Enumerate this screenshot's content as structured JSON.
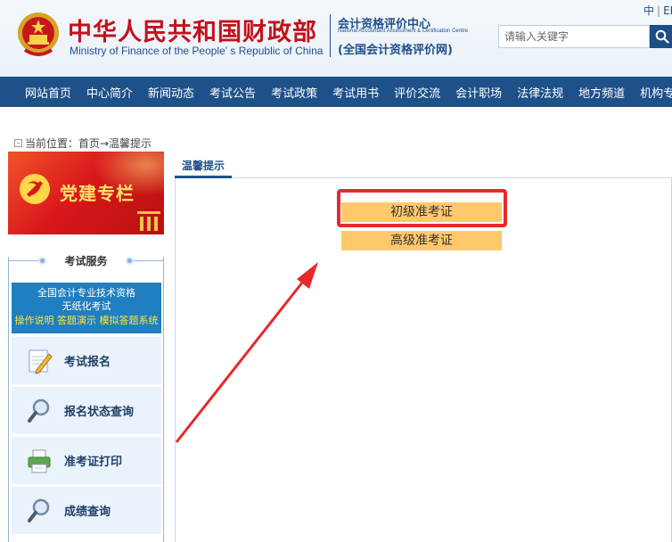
{
  "header": {
    "ministry_cn": "中华人民共和国财政部",
    "ministry_en": "Ministry of Finance of the People' s Republic of China",
    "center_cn": "会计资格评价中心",
    "center_en": "National Accountant Assessment & Certification Centre",
    "center_net": "(全国会计资格评价网)",
    "lang_cn": "中",
    "lang_sep": "|",
    "lang_en": "EN"
  },
  "search": {
    "placeholder": "请输入关键字",
    "button_icon": "search-icon"
  },
  "nav": {
    "items": [
      "网站首页",
      "中心简介",
      "新闻动态",
      "考试公告",
      "考试政策",
      "考试用书",
      "评价交流",
      "会计职场",
      "法律法规",
      "地方频道",
      "机构专区"
    ]
  },
  "breadcrumb": {
    "text": "当前位置：首页→温馨提示"
  },
  "sidebar": {
    "party_banner": "党建专栏",
    "service_title": "考试服务",
    "paperless": {
      "line1": "全国会计专业技术资格",
      "line2": "无纸化考试",
      "link1": "操作说明",
      "link2": "答题演示",
      "link3": "模拟答题系统"
    },
    "items": [
      {
        "label": "考试报名",
        "icon": "pencil-paper-icon"
      },
      {
        "label": "报名状态查询",
        "icon": "magnifier-icon"
      },
      {
        "label": "准考证打印",
        "icon": "printer-icon"
      },
      {
        "label": "成绩查询",
        "icon": "magnifier-icon"
      }
    ]
  },
  "main": {
    "tab_label": "温馨提示",
    "buttons": {
      "primary": "初级准考证",
      "senior": "高级准考证"
    }
  },
  "colors": {
    "nav_bg": "#1e5189",
    "ministry_red": "#c2121b",
    "button_bg": "#ffc96b",
    "annotation_red": "#e8282b"
  }
}
